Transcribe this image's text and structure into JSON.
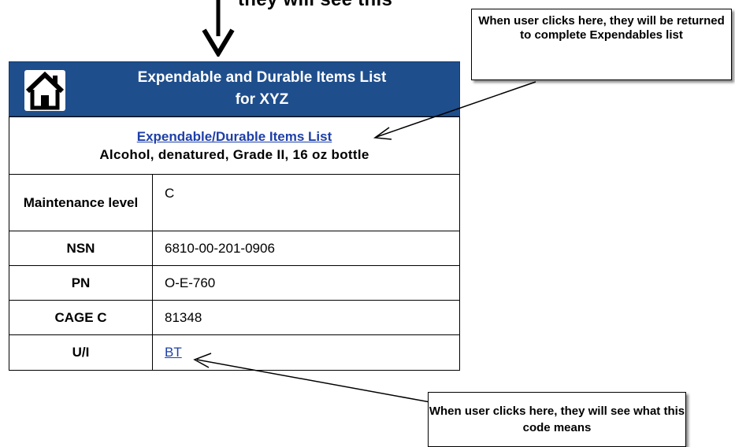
{
  "caption": {
    "top_text": "they will see this"
  },
  "header": {
    "title_line1": "Expendable and Durable Items List",
    "title_line2": "for XYZ",
    "home_icon": "home-icon",
    "bar_color": "#1f4e8c"
  },
  "item": {
    "list_link_label": "Expendable/Durable Items List",
    "name": "Alcohol, denatured,  Grade II, 16 oz bottle"
  },
  "details": [
    {
      "label": "Maintenance level",
      "value": "C"
    },
    {
      "label": "NSN",
      "value": "6810-00-201-0906"
    },
    {
      "label": "PN",
      "value": "O-E-760"
    },
    {
      "label": "CAGE C",
      "value": "81348"
    },
    {
      "label": "U/I",
      "value": "BT"
    }
  ],
  "callouts": {
    "top": "When user clicks here, they will be returned to complete Expendables list",
    "bottom": "When user clicks here, they will see what this code means"
  },
  "colors": {
    "link": "#1e3fa8",
    "header_bg": "#1f4e8c"
  }
}
